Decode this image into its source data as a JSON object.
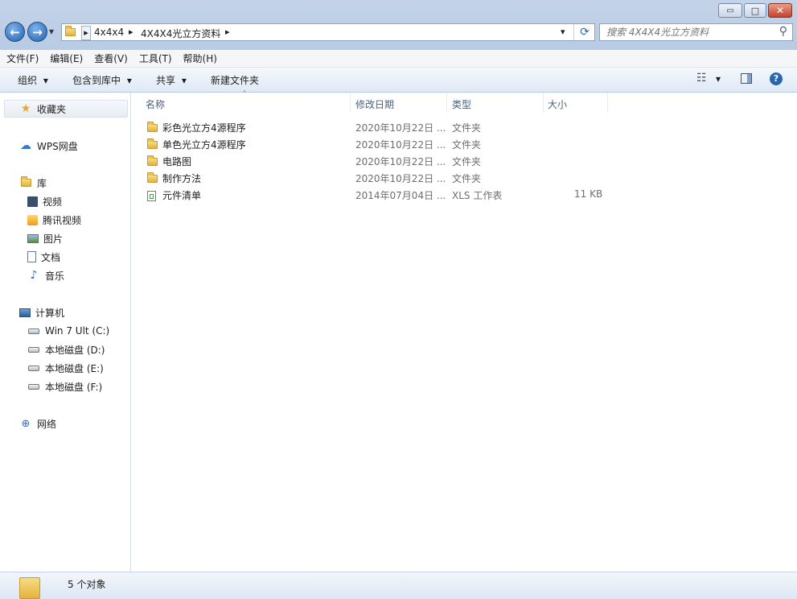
{
  "window": {
    "min_glyph": "▭",
    "max_glyph": "□",
    "close_glyph": "✕"
  },
  "nav": {
    "back_glyph": "←",
    "forward_glyph": "→",
    "history_glyph": "▾"
  },
  "address": {
    "breadcrumbs": [
      "4x4x4",
      "4X4X4光立方资料"
    ],
    "sep_glyph": "▸",
    "dropdown_glyph": "▾",
    "refresh_glyph": "⟳"
  },
  "search": {
    "placeholder": "搜索 4X4X4光立方资料",
    "icon_glyph": "⚲"
  },
  "menu": [
    "文件(F)",
    "编辑(E)",
    "查看(V)",
    "工具(T)",
    "帮助(H)"
  ],
  "toolbar": {
    "organize": "组织",
    "include_library": "包含到库中",
    "share": "共享",
    "new_folder": "新建文件夹",
    "dropdown_glyph": "▾",
    "views_glyph": "☷",
    "help_glyph": "?"
  },
  "sidebar": {
    "favorites": "收藏夹",
    "wps": "WPS网盘",
    "library": "库",
    "library_items": [
      "视频",
      "腾讯视频",
      "图片",
      "文档",
      "音乐"
    ],
    "computer": "计算机",
    "drives": [
      "Win 7 Ult (C:)",
      "本地磁盘 (D:)",
      "本地磁盘 (E:)",
      "本地磁盘 (F:)"
    ],
    "network": "网络"
  },
  "columns": {
    "name": "名称",
    "date": "修改日期",
    "type": "类型",
    "size": "大小",
    "sort_glyph": "ˆ"
  },
  "files": [
    {
      "name": "彩色光立方4源程序",
      "date": "2020年10月22日 ...",
      "type": "文件夹",
      "size": "",
      "icon": "folder-icon"
    },
    {
      "name": "单色光立方4源程序",
      "date": "2020年10月22日 ...",
      "type": "文件夹",
      "size": "",
      "icon": "folder-icon"
    },
    {
      "name": "电路图",
      "date": "2020年10月22日 ...",
      "type": "文件夹",
      "size": "",
      "icon": "folder-icon"
    },
    {
      "name": "制作方法",
      "date": "2020年10月22日 ...",
      "type": "文件夹",
      "size": "",
      "icon": "folder-icon"
    },
    {
      "name": "元件清单",
      "date": "2014年07月04日 ...",
      "type": "XLS 工作表",
      "size": "11 KB",
      "icon": "xls-file-icon"
    }
  ],
  "status": {
    "count": "5 个对象"
  },
  "colors": {
    "accent": "#1d5fae",
    "folder": "#e3b23e",
    "header_text": "#4c607a"
  }
}
